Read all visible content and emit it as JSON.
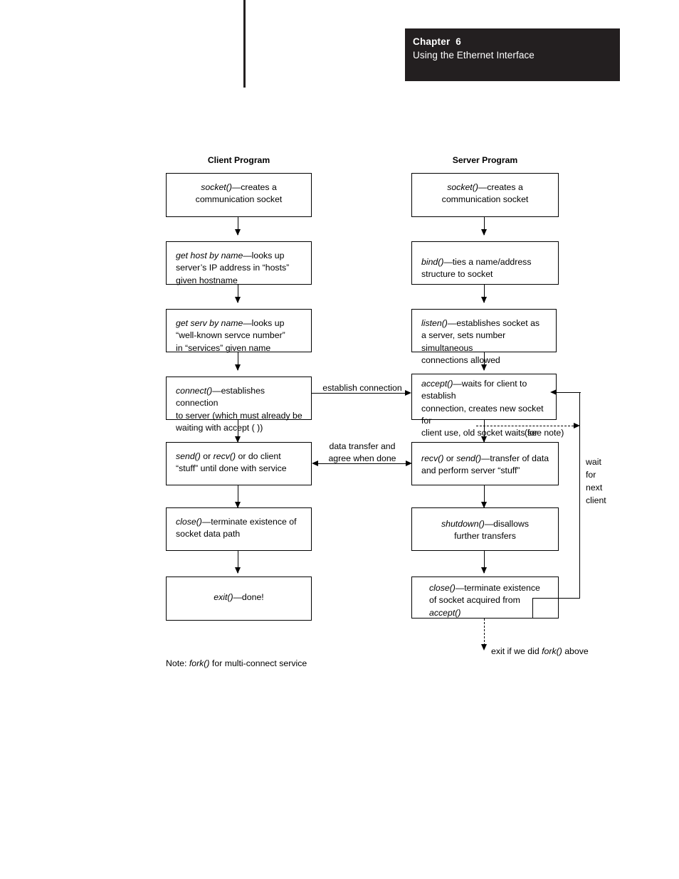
{
  "header": {
    "chapter_label": "Chapter  6",
    "chapter_subtitle": "Using the Ethernet Interface"
  },
  "diagram": {
    "client_column_title": "Client Program",
    "server_column_title": "Server Program",
    "client_steps": [
      {
        "fn": "socket()",
        "rest": "—creates a\ncommunication socket",
        "align": "center"
      },
      {
        "fn": "get host by name",
        "rest": "—looks up\nserver’s IP address in “hosts”\ngiven hostname",
        "align": "left"
      },
      {
        "fn": "get serv by name",
        "rest": "—looks up\n“well-known servce  number”\nin “services” given name",
        "align": "left"
      },
      {
        "fn": "connect()",
        "rest": "—establishes connection\nto server (which must already be\nwaiting with accept ( ))",
        "align": "left"
      },
      {
        "fn": "send()",
        "rest": " or ",
        "fn2": "recv()",
        "rest2": " or do client\n“stuff” until done with service",
        "align": "left"
      },
      {
        "fn": "close()",
        "rest": "—terminate existence of\nsocket data path",
        "align": "left"
      },
      {
        "fn": "exit()",
        "rest": "—done!",
        "align": "center"
      }
    ],
    "server_steps": [
      {
        "fn": "socket()",
        "rest": "—creates a\ncommunication socket",
        "align": "center"
      },
      {
        "fn": "bind()",
        "rest": "—ties a name/address\nstructure to socket",
        "align": "left"
      },
      {
        "fn": "listen()",
        "rest": "—establishes socket as\na server, sets number simultaneous\nconnections allowed",
        "align": "left"
      },
      {
        "fn": "accept()",
        "rest": "—waits for client to establish\nconnection, creates new socket for\nclient use, old socket waits for next\nconnect ( )",
        "align": "left"
      },
      {
        "fn": "recv()",
        "rest": " or ",
        "fn2": "send()",
        "rest2": "—transfer of data\nand perform server “stuff”",
        "align": "left"
      },
      {
        "fn": "shutdown()",
        "rest": "—disallows\nfurther transfers",
        "align": "center"
      },
      {
        "fn": "close()",
        "rest": "—terminate existence\nof socket acquired from\n",
        "fn2": "accept()",
        "rest2": "",
        "align": "left"
      }
    ],
    "connector_labels": {
      "establish_connection": "establish connection",
      "data_transfer": "data transfer and\nagree when done",
      "see_note": "(see note)",
      "wait_for_next_client": "wait\nfor\nnext\nclient"
    },
    "notes": {
      "note_prefix": "Note: ",
      "note_fn": "fork()",
      "note_rest": " for multi-connect service",
      "exit_prefix": "exit if we did ",
      "exit_fn": "fork()",
      "exit_rest": " above"
    }
  }
}
